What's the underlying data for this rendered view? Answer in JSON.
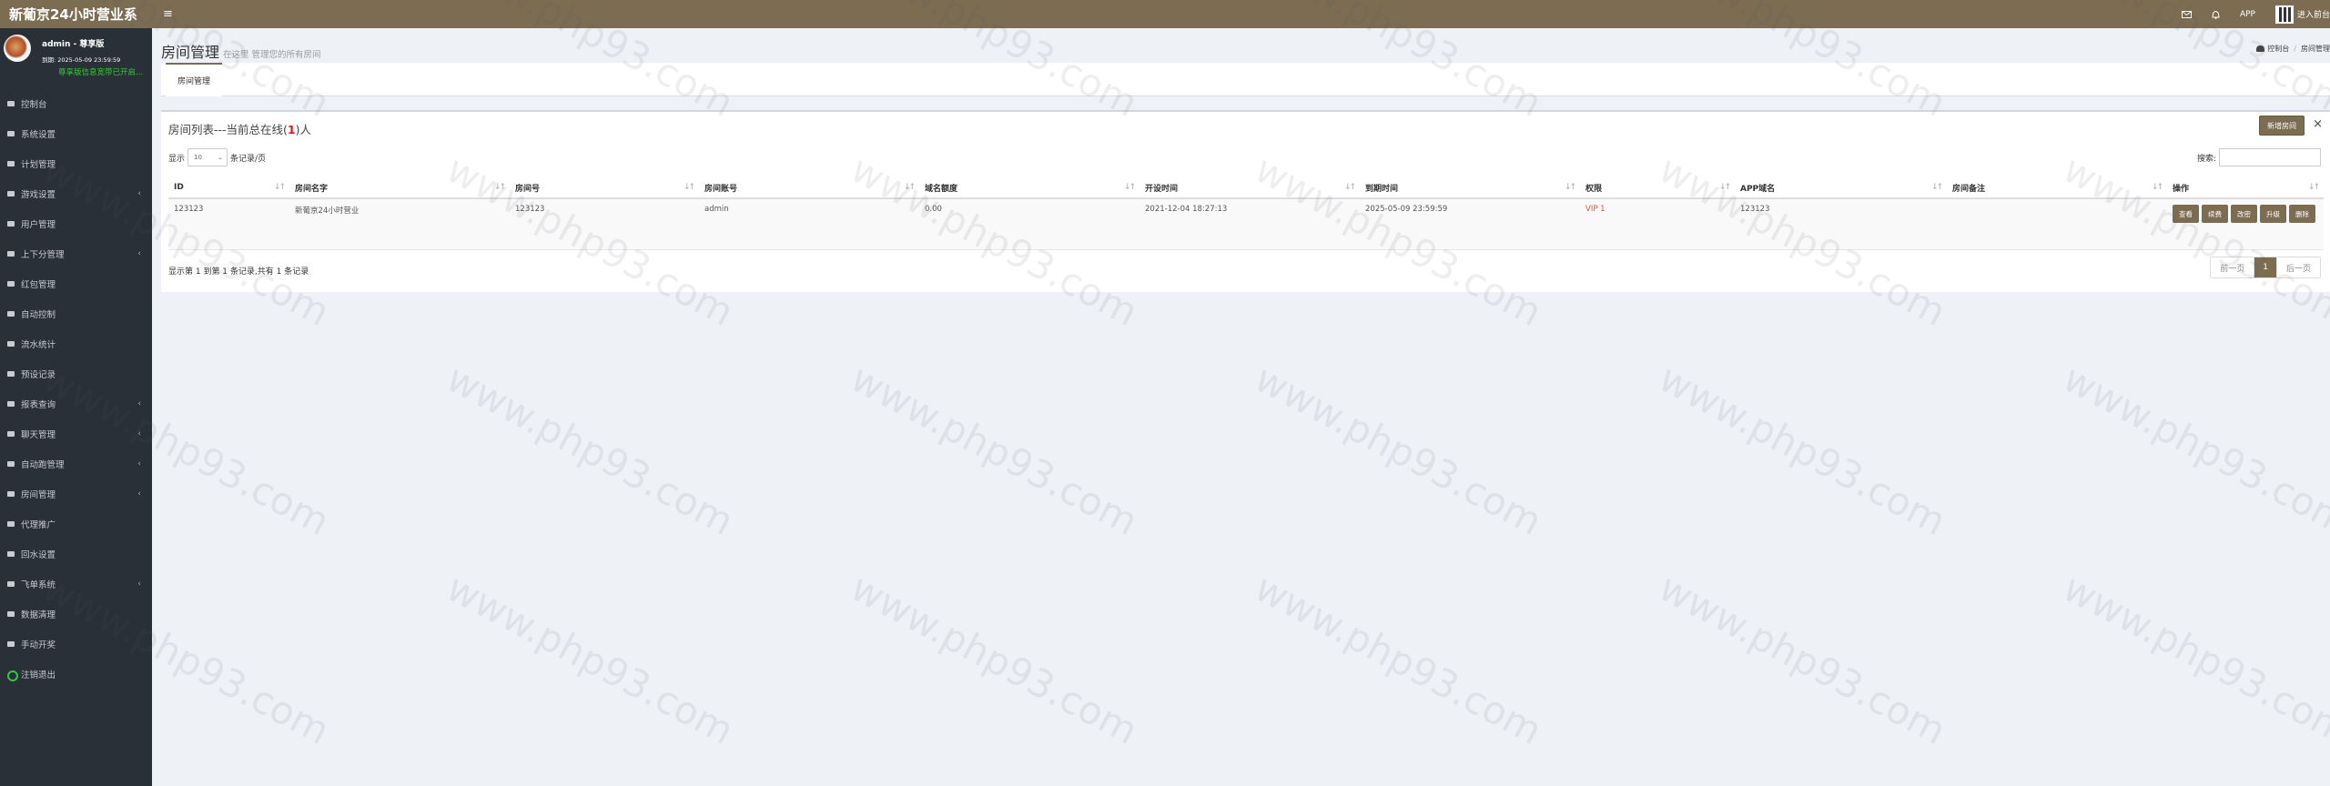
{
  "topbar": {
    "brand": "新葡京24小时营业系",
    "menu_toggle": "≡",
    "app_label": "APP",
    "enter_front": "进入前台"
  },
  "user": {
    "name": "admin - 尊享版",
    "expire": "到期: 2025-05-09 23:59:59",
    "notice": "尊享版信息宽带已开启..."
  },
  "nav": [
    {
      "label": "控制台",
      "icon": "dashboard-icon",
      "caret": false
    },
    {
      "label": "系统设置",
      "icon": "gears-icon",
      "caret": false
    },
    {
      "label": "计划管理",
      "icon": "list-icon",
      "caret": false
    },
    {
      "label": "游戏设置",
      "icon": "list-icon",
      "caret": true
    },
    {
      "label": "用户管理",
      "icon": "user-icon",
      "caret": false
    },
    {
      "label": "上下分管理",
      "icon": "list-icon",
      "caret": true
    },
    {
      "label": "红包管理",
      "icon": "list-icon",
      "caret": false
    },
    {
      "label": "自动控制",
      "icon": "list-icon",
      "caret": false
    },
    {
      "label": "流水统计",
      "icon": "cart-icon",
      "caret": false
    },
    {
      "label": "预设记录",
      "icon": "list-icon",
      "caret": false
    },
    {
      "label": "报表查询",
      "icon": "list-icon",
      "caret": true
    },
    {
      "label": "聊天管理",
      "icon": "chat-icon",
      "caret": true
    },
    {
      "label": "自动跑管理",
      "icon": "chat-icon",
      "caret": true
    },
    {
      "label": "房间管理",
      "icon": "chat-icon",
      "caret": true
    },
    {
      "label": "代理推广",
      "icon": "users-icon",
      "caret": false
    },
    {
      "label": "回水设置",
      "icon": "cloud-icon",
      "caret": false
    },
    {
      "label": "飞单系统",
      "icon": "plane-icon",
      "caret": true
    },
    {
      "label": "数据清理",
      "icon": "gear-icon",
      "caret": false
    },
    {
      "label": "手动开奖",
      "icon": "users-icon",
      "caret": false
    },
    {
      "label": "注销退出",
      "icon": "logout-icon",
      "caret": false
    }
  ],
  "header": {
    "title": "房间管理",
    "subtitle": "在这里 管理您的所有房间",
    "breadcrumb": [
      "控制台",
      "房间管理"
    ],
    "tab": "房间管理"
  },
  "box": {
    "title_prefix": "房间列表---当前总在线(",
    "online_count": "1",
    "title_suffix": ")人",
    "new_button": "新增房间",
    "close": "×",
    "length_prefix": "显示",
    "length_value": "10",
    "length_suffix": "条记录/页",
    "search_label": "搜索:"
  },
  "table": {
    "columns": [
      "ID",
      "房间名字",
      "房间号",
      "房间账号",
      "域名额度",
      "开设时间",
      "到期时间",
      "权限",
      "APP域名",
      "房间备注",
      "操作"
    ],
    "rows": [
      [
        "123123",
        "新葡京24小时营业",
        "123123",
        "admin",
        "0.00",
        "2021-12-04 18:27:13",
        "2025-05-09 23:59:59",
        "VIP 1",
        "123123",
        ""
      ]
    ],
    "actions": [
      "查看",
      "续费",
      "改密",
      "升级",
      "删除"
    ]
  },
  "footer": {
    "info": "显示第 1 到第 1 条记录,共有 1 条记录",
    "prev": "前一页",
    "page": "1",
    "next": "后一页"
  },
  "watermark": "www.php93.com",
  "colors": {
    "accent": "#7b6c52",
    "sidebar": "#2a3038",
    "vip": "#e74c3c",
    "notice": "#2cd12c"
  }
}
